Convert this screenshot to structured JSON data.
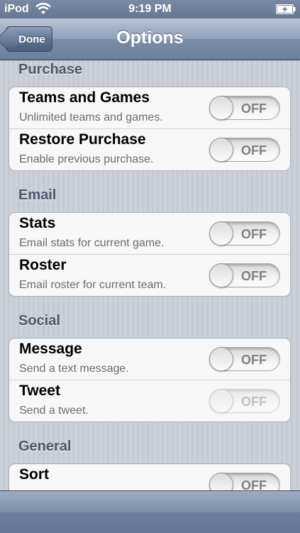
{
  "status_bar": {
    "carrier": "iPod",
    "time": "9:19 PM",
    "wifi_icon": "wifi-icon",
    "battery_icon": "battery-charging-icon"
  },
  "nav": {
    "done_label": "Done",
    "title": "Options"
  },
  "sections": [
    {
      "header": "Purchase",
      "rows": [
        {
          "title": "Teams and Games",
          "subtitle": "Unlimited teams and games.",
          "toggle": "OFF",
          "enabled": true
        },
        {
          "title": "Restore Purchase",
          "subtitle": "Enable previous purchase.",
          "toggle": "OFF",
          "enabled": true
        }
      ]
    },
    {
      "header": "Email",
      "rows": [
        {
          "title": "Stats",
          "subtitle": "Email stats for current game.",
          "toggle": "OFF",
          "enabled": true
        },
        {
          "title": "Roster",
          "subtitle": "Email roster for current team.",
          "toggle": "OFF",
          "enabled": true
        }
      ]
    },
    {
      "header": "Social",
      "rows": [
        {
          "title": "Message",
          "subtitle": "Send a text message.",
          "toggle": "OFF",
          "enabled": true
        },
        {
          "title": "Tweet",
          "subtitle": "Send a tweet.",
          "toggle": "OFF",
          "enabled": false
        }
      ]
    },
    {
      "header": "General",
      "rows": [
        {
          "title": "Sort",
          "subtitle": "",
          "toggle": "OFF",
          "enabled": true
        }
      ]
    }
  ],
  "colors": {
    "nav_bar": "#7a8ca7",
    "section_header": "#4c566c",
    "background": "#c8ccd5"
  }
}
